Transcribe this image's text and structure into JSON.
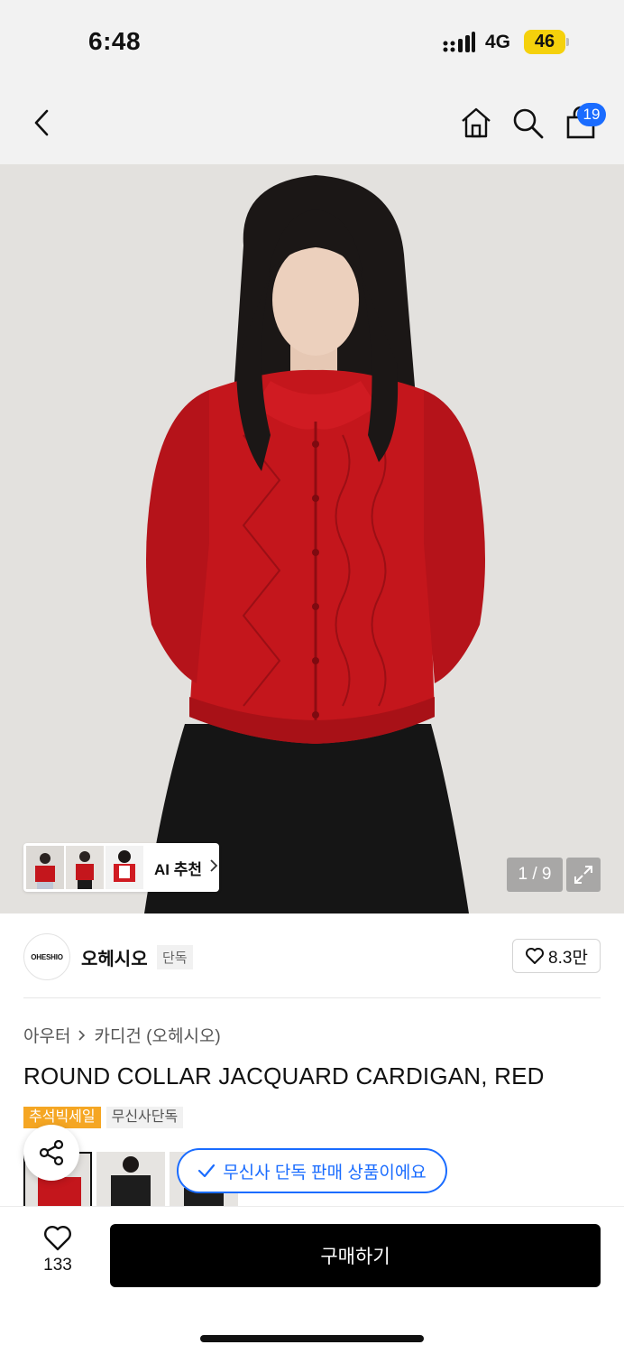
{
  "status_bar": {
    "time": "6:48",
    "network": "4G",
    "battery": "46"
  },
  "nav": {
    "cart_count": "19",
    "icons": [
      "back-chevron-icon",
      "home-icon",
      "search-icon",
      "shopping-bag-icon"
    ]
  },
  "gallery": {
    "page_current": "1",
    "page_total": "9",
    "page_label": "1 / 9",
    "ai_recommend_label": "AI 추천",
    "colors": {
      "cardigan": "#c4161c",
      "skirt": "#151515",
      "background": "#e3e1de"
    }
  },
  "brand": {
    "name": "오헤시오",
    "logo_text": "OHESHIO",
    "exclusive_tag": "단독",
    "likes": "8.3만"
  },
  "product": {
    "breadcrumb": [
      "아우터",
      "카디건 (오헤시오)"
    ],
    "title": "ROUND COLLAR JACQUARD CARDIGAN, RED",
    "tags": [
      "추석빅세일",
      "무신사단독"
    ]
  },
  "toast": {
    "text": "무신사 단독 판매 상품이에요"
  },
  "bottom_bar": {
    "wish_count": "133",
    "buy_label": "구매하기"
  },
  "accent_colors": {
    "blue": "#1a6cff",
    "sale_orange": "#f5a623",
    "buy_black": "#000000"
  }
}
